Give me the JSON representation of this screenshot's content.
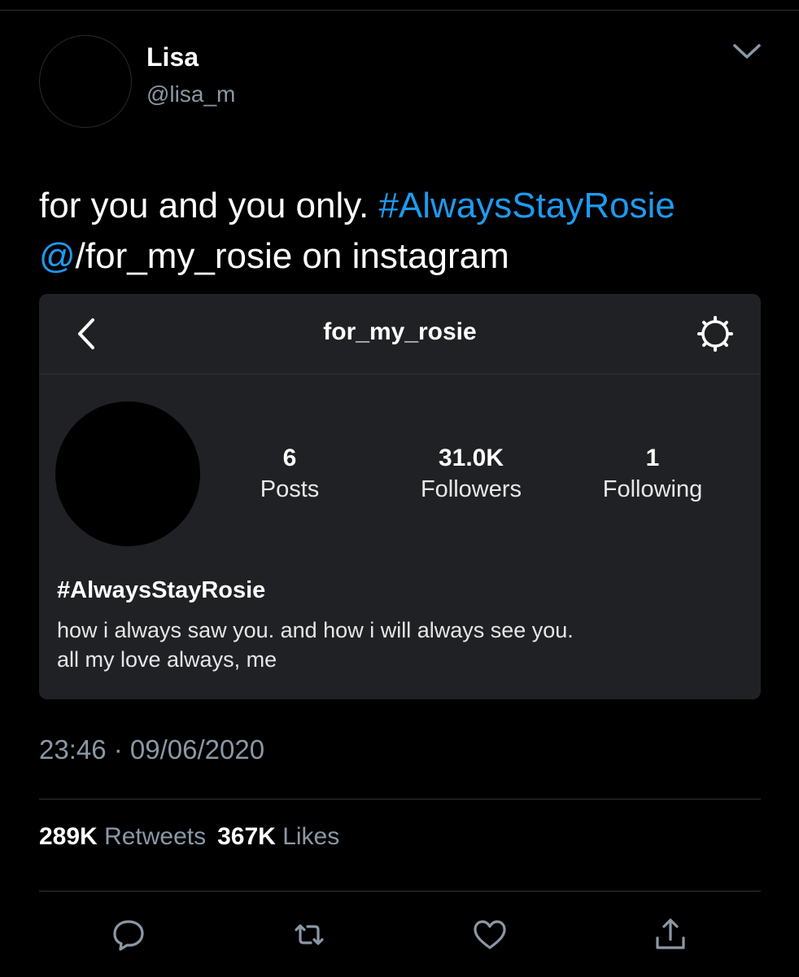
{
  "tweet": {
    "author": {
      "display_name": "Lisa",
      "handle": "@lisa_m"
    },
    "text": {
      "part1": "for you and you only. ",
      "hashtag": "#AlwaysStayRosie",
      "mention": "@",
      "part2": "/for_my_rosie on instagram"
    },
    "timestamp": "23:46 · 09/06/2020",
    "stats": {
      "retweets_count": "289K",
      "retweets_label": "Retweets",
      "likes_count": "367K",
      "likes_label": "Likes"
    }
  },
  "instagram_card": {
    "username": "for_my_rosie",
    "stats": [
      {
        "value": "6",
        "label": "Posts"
      },
      {
        "value": "31.0K",
        "label": "Followers"
      },
      {
        "value": "1",
        "label": "Following"
      }
    ],
    "bio_name": "#AlwaysStayRosie",
    "bio_lines": [
      "how i always saw you. and how i will always see you.",
      "all my love always, me"
    ]
  },
  "icons": {
    "menu": "chevron-down-icon",
    "back": "back-arrow-icon",
    "settings": "gear-icon",
    "reply": "reply-icon",
    "retweet": "retweet-icon",
    "like": "heart-icon",
    "share": "share-icon"
  },
  "colors": {
    "background": "#000000",
    "card": "#202124",
    "link": "#1d9bf0",
    "secondary_text": "#8b98a5"
  }
}
